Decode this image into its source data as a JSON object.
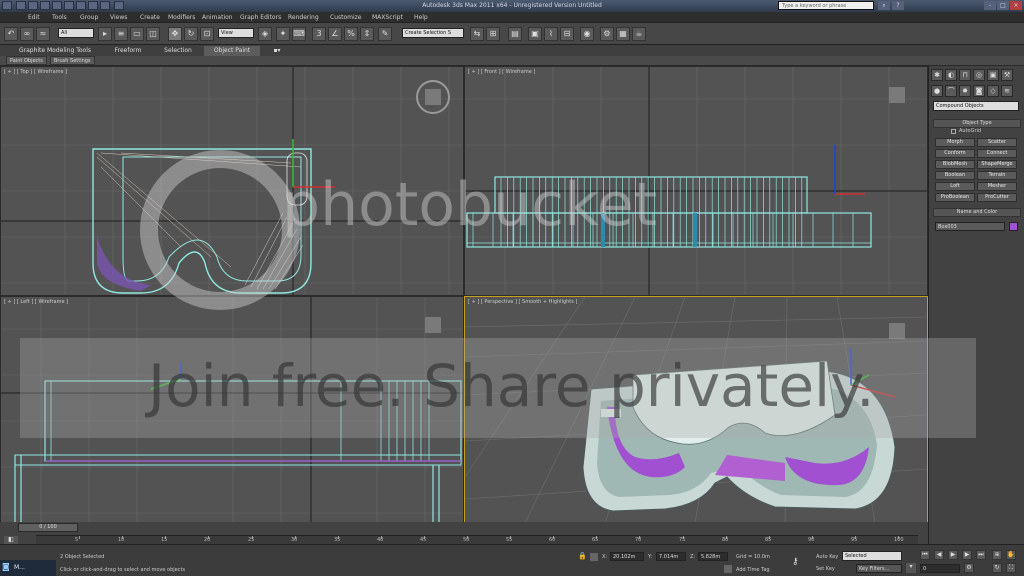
{
  "window": {
    "title": "Autodesk 3ds Max  2011 x64  -  Unregistered Version    Untitled",
    "search_placeholder": "Type a keyword or phrase",
    "controls": [
      "-",
      "□",
      "×"
    ]
  },
  "menu": [
    "Edit",
    "Tools",
    "Group",
    "Views",
    "Create",
    "Modifiers",
    "Animation",
    "Graph Editors",
    "Rendering",
    "Customize",
    "MAXScript",
    "Help"
  ],
  "toolbar": {
    "selection_filter": "All",
    "reference_coord": "View",
    "named_selection": "Create Selection S"
  },
  "ribbon": {
    "tabs": [
      "Graphite Modeling Tools",
      "Freeform",
      "Selection",
      "Object Paint"
    ],
    "active_tab": "Object Paint",
    "subtabs": [
      "Paint Objects",
      "Brush Settings"
    ]
  },
  "viewports": {
    "top": "[ + ] [ Top ] [ Wireframe ]",
    "front": "[ + ] [ Front ] [ Wireframe ]",
    "left": "[ + ] [ Left ] [ Wireframe ]",
    "perspective": "[ + ] [ Perspective ] [ Smooth + Highlights ]"
  },
  "command_panel": {
    "category": "Compound Objects",
    "object_type_header": "Object Type",
    "autogrid": "AutoGrid",
    "buttons": [
      "Morph",
      "Scatter",
      "Conform",
      "Connect",
      "BlobMesh",
      "ShapeMerge",
      "Boolean",
      "Terrain",
      "Loft",
      "Mesher",
      "ProBoolean",
      "ProCutter"
    ],
    "name_color_header": "Name and Color",
    "object_name": "Box003",
    "object_color": "#a050d0"
  },
  "timeline": {
    "slider": "0 / 100",
    "ticks": [
      "5",
      "10",
      "15",
      "20",
      "25",
      "30",
      "35",
      "40",
      "45",
      "50",
      "55",
      "60",
      "65",
      "70",
      "75",
      "80",
      "85",
      "90",
      "95",
      "100"
    ]
  },
  "status": {
    "selected": "2 Object Selected",
    "prompt": "Click or click-and-drag to select and move objects",
    "x_label": "X:",
    "x": "20.102m",
    "y_label": "Y:",
    "y": "7.014m",
    "z_label": "Z:",
    "z": "5.828m",
    "grid": "Grid = 10.0m",
    "add_time_tag": "Add Time Tag",
    "auto_key": "Auto Key",
    "set_key": "Set Key",
    "key_mode": "Selected",
    "key_filters": "Key Filters...",
    "frame": "0"
  },
  "taskbar": {
    "item": "M..."
  },
  "watermark": {
    "logo": "photobucket",
    "tagline": "Join free. Share privately."
  },
  "colors": {
    "wire": "#8fe8e0",
    "purple": "#a050d0",
    "grid": "#6a6a6a",
    "active_border": "#c8a020"
  }
}
